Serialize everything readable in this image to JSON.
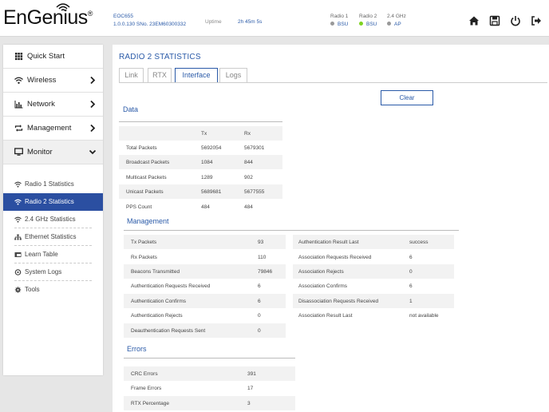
{
  "header": {
    "logo_text": "EnGenius",
    "logo_reg": "®",
    "device_model": "EOC655",
    "device_firmware": "1.0.0.130 SNo. 23EM60300332",
    "uptime_label": "Uptime",
    "uptime_value": "2h 45m 5s",
    "radios": [
      {
        "title": "Radio 1",
        "status": "BSU",
        "color": "#999999"
      },
      {
        "title": "Radio 2",
        "status": "BSU",
        "color": "#7ed321"
      },
      {
        "title": "2.4 GHz",
        "status": "AP",
        "color": "#999999"
      }
    ],
    "icons": [
      "home-icon",
      "save-icon",
      "power-icon",
      "logout-icon"
    ]
  },
  "sidebar": {
    "items": [
      {
        "label": "Quick Start",
        "icon": "grid-icon"
      },
      {
        "label": "Wireless",
        "icon": "wifi-icon"
      },
      {
        "label": "Network",
        "icon": "bar-chart-icon"
      },
      {
        "label": "Management",
        "icon": "sync-icon"
      },
      {
        "label": "Monitor",
        "icon": "monitor-icon"
      }
    ],
    "sub_items": [
      {
        "label": "Radio 1 Statistics",
        "icon": "wifi-icon"
      },
      {
        "label": "Radio 2 Statistics",
        "icon": "wifi-icon"
      },
      {
        "label": "2.4 GHz Statistics",
        "icon": "wifi-icon"
      },
      {
        "label": "Ethernet Statistics",
        "icon": "network-icon"
      },
      {
        "label": "Learn Table",
        "icon": "table-icon"
      },
      {
        "label": "System Logs",
        "icon": "log-icon"
      },
      {
        "label": "Tools",
        "icon": "gear-icon"
      }
    ]
  },
  "main": {
    "title": "RADIO 2 STATISTICS",
    "tabs": [
      "Link",
      "RTX",
      "Interface",
      "Logs"
    ],
    "active_tab": "Interface",
    "clear_label": "Clear",
    "data_section": {
      "title": "Data",
      "col_tx": "Tx",
      "col_rx": "Rx",
      "rows": [
        {
          "label": "Total Packets",
          "tx": "5692054",
          "rx": "5679301"
        },
        {
          "label": "Broadcast Packets",
          "tx": "1084",
          "rx": "844"
        },
        {
          "label": "Multicast Packets",
          "tx": "1289",
          "rx": "902"
        },
        {
          "label": "Unicast Packets",
          "tx": "5689681",
          "rx": "5677555"
        },
        {
          "label": "PPS Count",
          "tx": "484",
          "rx": "484"
        }
      ]
    },
    "management_section": {
      "title": "Management",
      "left_rows": [
        {
          "label": "Tx Packets",
          "value": "93"
        },
        {
          "label": "Rx Packets",
          "value": "110"
        },
        {
          "label": "Beacons Transmitted",
          "value": "79846"
        },
        {
          "label": "Authentication Requests Received",
          "value": "6"
        },
        {
          "label": "Authentication Confirms",
          "value": "6"
        },
        {
          "label": "Authentication Rejects",
          "value": "0"
        },
        {
          "label": "Deauthentication Requests Sent",
          "value": "0"
        }
      ],
      "right_rows": [
        {
          "label": "Authentication Result Last",
          "value": "success"
        },
        {
          "label": "Association Requests Received",
          "value": "6"
        },
        {
          "label": "Association Rejects",
          "value": "0"
        },
        {
          "label": "Association Confirms",
          "value": "6"
        },
        {
          "label": "Disassociation Requests Received",
          "value": "1"
        },
        {
          "label": "Association Result Last",
          "value": "not available"
        }
      ]
    },
    "errors_section": {
      "title": "Errors",
      "rows": [
        {
          "label": "CRC Errors",
          "value": "391"
        },
        {
          "label": "Frame Errors",
          "value": "17"
        },
        {
          "label": "RTX Percentage",
          "value": "3"
        }
      ]
    }
  }
}
